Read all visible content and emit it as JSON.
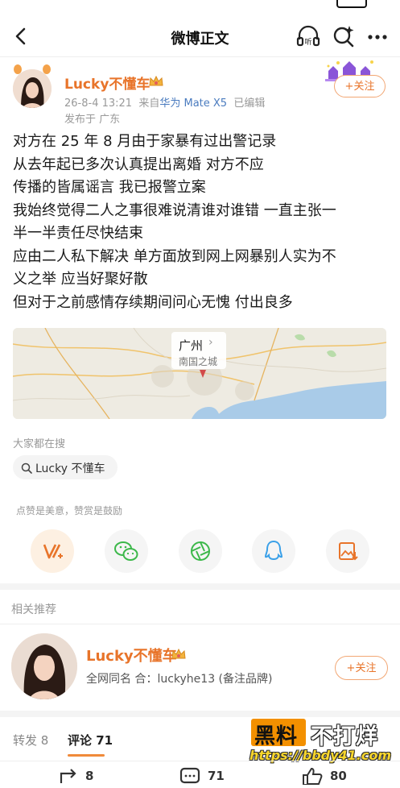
{
  "nav": {
    "title": "微博正文"
  },
  "post": {
    "author": "Lucky不懂车",
    "meta_time": "26-8-4 13:21",
    "meta_from": "来自",
    "meta_device": "华为 Mate X5",
    "meta_edited": "已编辑",
    "location": "发布于 广东",
    "follow_label": "+关注",
    "lines": [
      "对方在 25 年 8 月由于家暴有过出警记录",
      "从去年起已多次认真提出离婚 对方不应",
      "传播的皆属谣言 我已报警立案",
      "我始终觉得二人之事很难说清谁对谁错 一直主张一",
      "半一半责任尽快结束",
      "应由二人私下解决 单方面放到网上网暴别人实为不",
      "义之举 应当好聚好散",
      "但对于之前感情存续期间问心无愧 付出良多"
    ]
  },
  "map": {
    "city": "广州",
    "subtitle": "南国之城"
  },
  "hot_search": {
    "label": "大家都在搜",
    "chip": "Lucky 不懂车"
  },
  "praise_text": "点赞是美意，赞赏是鼓励",
  "related": {
    "label": "相关推荐",
    "name": "Lucky不懂车",
    "desc": "全网同名 合：luckyhe13 (备注品牌)",
    "follow_label": "+关注"
  },
  "tabs": {
    "repost": "转发 8",
    "comment": "评论 71"
  },
  "watermark": {
    "part1": "黑料",
    "part2": "不打烊",
    "url": "https://bbdy41.com"
  },
  "bottom_bar": {
    "repost_count": "8",
    "comment_count": "71",
    "like_count": "80"
  },
  "colors": {
    "accent_orange": "#e8742a",
    "link_blue": "#4a7bbf",
    "map_water": "#a9cbe8"
  }
}
